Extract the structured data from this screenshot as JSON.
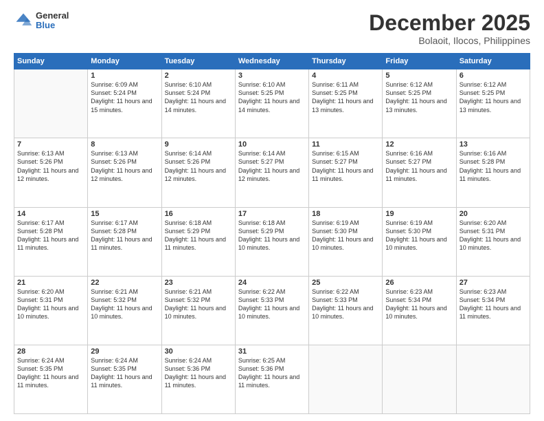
{
  "header": {
    "logo_general": "General",
    "logo_blue": "Blue",
    "title": "December 2025",
    "subtitle": "Bolaoit, Ilocos, Philippines"
  },
  "columns": [
    "Sunday",
    "Monday",
    "Tuesday",
    "Wednesday",
    "Thursday",
    "Friday",
    "Saturday"
  ],
  "weeks": [
    [
      {
        "day": "",
        "sunrise": "",
        "sunset": "",
        "daylight": ""
      },
      {
        "day": "1",
        "sunrise": "6:09 AM",
        "sunset": "5:24 PM",
        "daylight": "11 hours and 15 minutes."
      },
      {
        "day": "2",
        "sunrise": "6:10 AM",
        "sunset": "5:24 PM",
        "daylight": "11 hours and 14 minutes."
      },
      {
        "day": "3",
        "sunrise": "6:10 AM",
        "sunset": "5:25 PM",
        "daylight": "11 hours and 14 minutes."
      },
      {
        "day": "4",
        "sunrise": "6:11 AM",
        "sunset": "5:25 PM",
        "daylight": "11 hours and 13 minutes."
      },
      {
        "day": "5",
        "sunrise": "6:12 AM",
        "sunset": "5:25 PM",
        "daylight": "11 hours and 13 minutes."
      },
      {
        "day": "6",
        "sunrise": "6:12 AM",
        "sunset": "5:25 PM",
        "daylight": "11 hours and 13 minutes."
      }
    ],
    [
      {
        "day": "7",
        "sunrise": "6:13 AM",
        "sunset": "5:26 PM",
        "daylight": "11 hours and 12 minutes."
      },
      {
        "day": "8",
        "sunrise": "6:13 AM",
        "sunset": "5:26 PM",
        "daylight": "11 hours and 12 minutes."
      },
      {
        "day": "9",
        "sunrise": "6:14 AM",
        "sunset": "5:26 PM",
        "daylight": "11 hours and 12 minutes."
      },
      {
        "day": "10",
        "sunrise": "6:14 AM",
        "sunset": "5:27 PM",
        "daylight": "11 hours and 12 minutes."
      },
      {
        "day": "11",
        "sunrise": "6:15 AM",
        "sunset": "5:27 PM",
        "daylight": "11 hours and 11 minutes."
      },
      {
        "day": "12",
        "sunrise": "6:16 AM",
        "sunset": "5:27 PM",
        "daylight": "11 hours and 11 minutes."
      },
      {
        "day": "13",
        "sunrise": "6:16 AM",
        "sunset": "5:28 PM",
        "daylight": "11 hours and 11 minutes."
      }
    ],
    [
      {
        "day": "14",
        "sunrise": "6:17 AM",
        "sunset": "5:28 PM",
        "daylight": "11 hours and 11 minutes."
      },
      {
        "day": "15",
        "sunrise": "6:17 AM",
        "sunset": "5:28 PM",
        "daylight": "11 hours and 11 minutes."
      },
      {
        "day": "16",
        "sunrise": "6:18 AM",
        "sunset": "5:29 PM",
        "daylight": "11 hours and 11 minutes."
      },
      {
        "day": "17",
        "sunrise": "6:18 AM",
        "sunset": "5:29 PM",
        "daylight": "11 hours and 10 minutes."
      },
      {
        "day": "18",
        "sunrise": "6:19 AM",
        "sunset": "5:30 PM",
        "daylight": "11 hours and 10 minutes."
      },
      {
        "day": "19",
        "sunrise": "6:19 AM",
        "sunset": "5:30 PM",
        "daylight": "11 hours and 10 minutes."
      },
      {
        "day": "20",
        "sunrise": "6:20 AM",
        "sunset": "5:31 PM",
        "daylight": "11 hours and 10 minutes."
      }
    ],
    [
      {
        "day": "21",
        "sunrise": "6:20 AM",
        "sunset": "5:31 PM",
        "daylight": "11 hours and 10 minutes."
      },
      {
        "day": "22",
        "sunrise": "6:21 AM",
        "sunset": "5:32 PM",
        "daylight": "11 hours and 10 minutes."
      },
      {
        "day": "23",
        "sunrise": "6:21 AM",
        "sunset": "5:32 PM",
        "daylight": "11 hours and 10 minutes."
      },
      {
        "day": "24",
        "sunrise": "6:22 AM",
        "sunset": "5:33 PM",
        "daylight": "11 hours and 10 minutes."
      },
      {
        "day": "25",
        "sunrise": "6:22 AM",
        "sunset": "5:33 PM",
        "daylight": "11 hours and 10 minutes."
      },
      {
        "day": "26",
        "sunrise": "6:23 AM",
        "sunset": "5:34 PM",
        "daylight": "11 hours and 10 minutes."
      },
      {
        "day": "27",
        "sunrise": "6:23 AM",
        "sunset": "5:34 PM",
        "daylight": "11 hours and 11 minutes."
      }
    ],
    [
      {
        "day": "28",
        "sunrise": "6:24 AM",
        "sunset": "5:35 PM",
        "daylight": "11 hours and 11 minutes."
      },
      {
        "day": "29",
        "sunrise": "6:24 AM",
        "sunset": "5:35 PM",
        "daylight": "11 hours and 11 minutes."
      },
      {
        "day": "30",
        "sunrise": "6:24 AM",
        "sunset": "5:36 PM",
        "daylight": "11 hours and 11 minutes."
      },
      {
        "day": "31",
        "sunrise": "6:25 AM",
        "sunset": "5:36 PM",
        "daylight": "11 hours and 11 minutes."
      },
      {
        "day": "",
        "sunrise": "",
        "sunset": "",
        "daylight": ""
      },
      {
        "day": "",
        "sunrise": "",
        "sunset": "",
        "daylight": ""
      },
      {
        "day": "",
        "sunrise": "",
        "sunset": "",
        "daylight": ""
      }
    ]
  ],
  "labels": {
    "sunrise": "Sunrise:",
    "sunset": "Sunset:",
    "daylight": "Daylight:"
  }
}
